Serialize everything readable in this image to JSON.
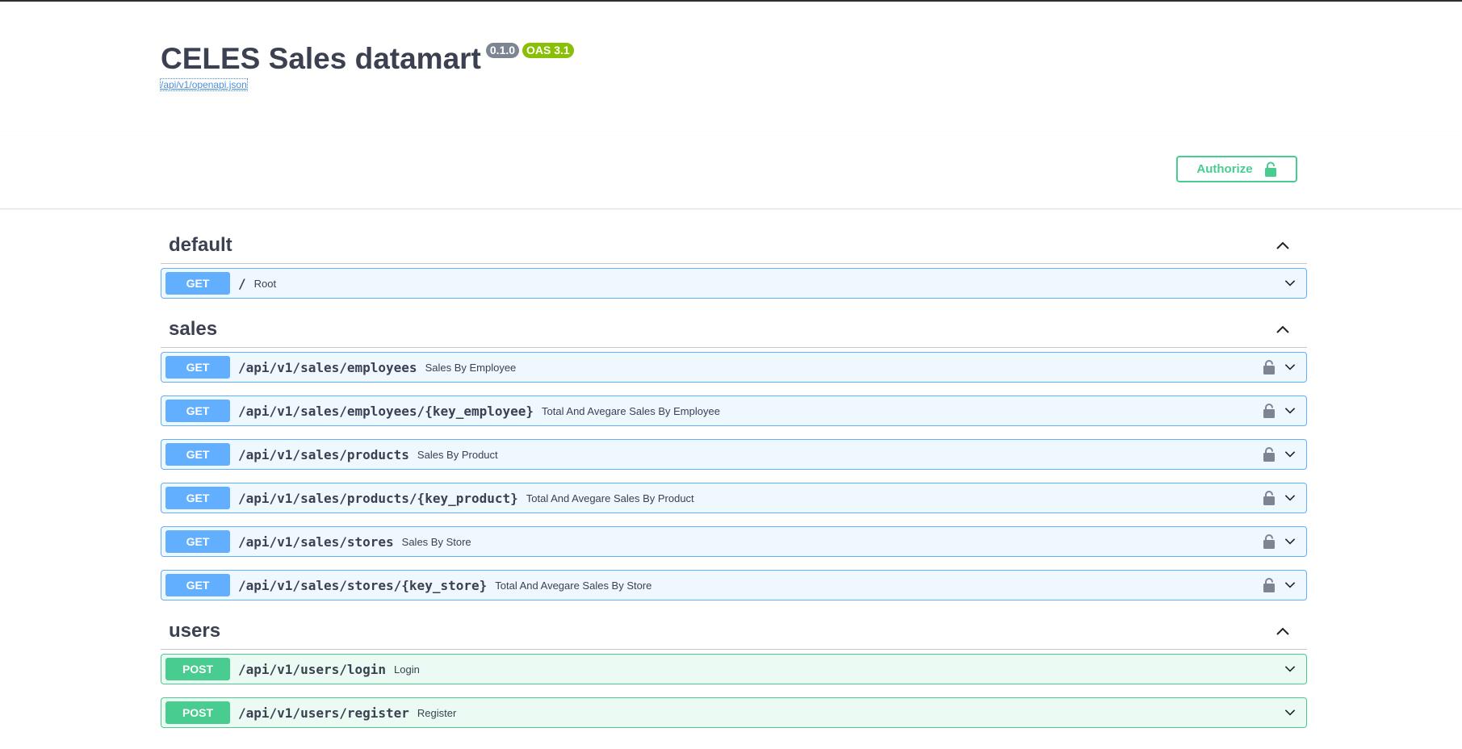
{
  "info": {
    "title": "CELES Sales datamart",
    "version": "0.1.0",
    "oas": "OAS 3.1",
    "spec_url": "/api/v1/openapi.json"
  },
  "auth": {
    "label": "Authorize",
    "icon": "unlock-icon"
  },
  "colors": {
    "get": "#61affe",
    "post": "#49cc90",
    "text": "#3b4151"
  },
  "tags": [
    {
      "name": "default",
      "operations": [
        {
          "method": "GET",
          "path": "/",
          "summary": "Root",
          "locked": false
        }
      ]
    },
    {
      "name": "sales",
      "operations": [
        {
          "method": "GET",
          "path": "/api/v1/sales/employees",
          "summary": "Sales By Employee",
          "locked": true
        },
        {
          "method": "GET",
          "path": "/api/v1/sales/employees/{key_employee}",
          "summary": "Total And Avegare Sales By Employee",
          "locked": true
        },
        {
          "method": "GET",
          "path": "/api/v1/sales/products",
          "summary": "Sales By Product",
          "locked": true
        },
        {
          "method": "GET",
          "path": "/api/v1/sales/products/{key_product}",
          "summary": "Total And Avegare Sales By Product",
          "locked": true
        },
        {
          "method": "GET",
          "path": "/api/v1/sales/stores",
          "summary": "Sales By Store",
          "locked": true
        },
        {
          "method": "GET",
          "path": "/api/v1/sales/stores/{key_store}",
          "summary": "Total And Avegare Sales By Store",
          "locked": true
        }
      ]
    },
    {
      "name": "users",
      "operations": [
        {
          "method": "POST",
          "path": "/api/v1/users/login",
          "summary": "Login",
          "locked": false
        },
        {
          "method": "POST",
          "path": "/api/v1/users/register",
          "summary": "Register",
          "locked": false
        }
      ]
    }
  ]
}
